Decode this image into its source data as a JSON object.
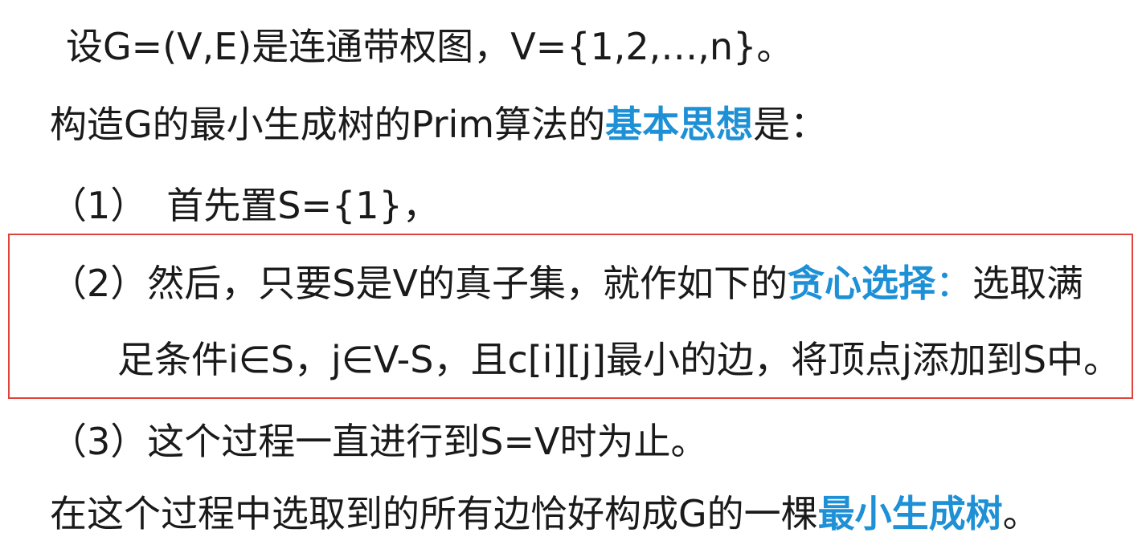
{
  "line1": {
    "text": "设G=(V,E)是连通带权图，V={1,2,…,n}。"
  },
  "line2": {
    "before": "构造G的最小生成树的Prim算法的",
    "highlight": "基本思想",
    "after": "是："
  },
  "line3": {
    "marker": "（1）",
    "text": "首先置S={1}，"
  },
  "line4": {
    "marker": "（2）",
    "before": "然后，只要S是V的真子集，就作如下的",
    "highlight": "贪心选择",
    "colon": "：",
    "after": "选取满"
  },
  "line5": {
    "text": "足条件i∈S，j∈V-S，且c[i][j]最小的边，将顶点j添加到S中。"
  },
  "line6": {
    "marker": "（3）",
    "text": "这个过程一直进行到S=V时为止。"
  },
  "line7": {
    "before": "在这个过程中选取到的所有边恰好构成G的一棵",
    "highlight": "最小生成树",
    "after": "。"
  },
  "colors": {
    "highlight": "#1e90d6",
    "box_border": "#e0433a",
    "text": "#1a1a1a"
  }
}
